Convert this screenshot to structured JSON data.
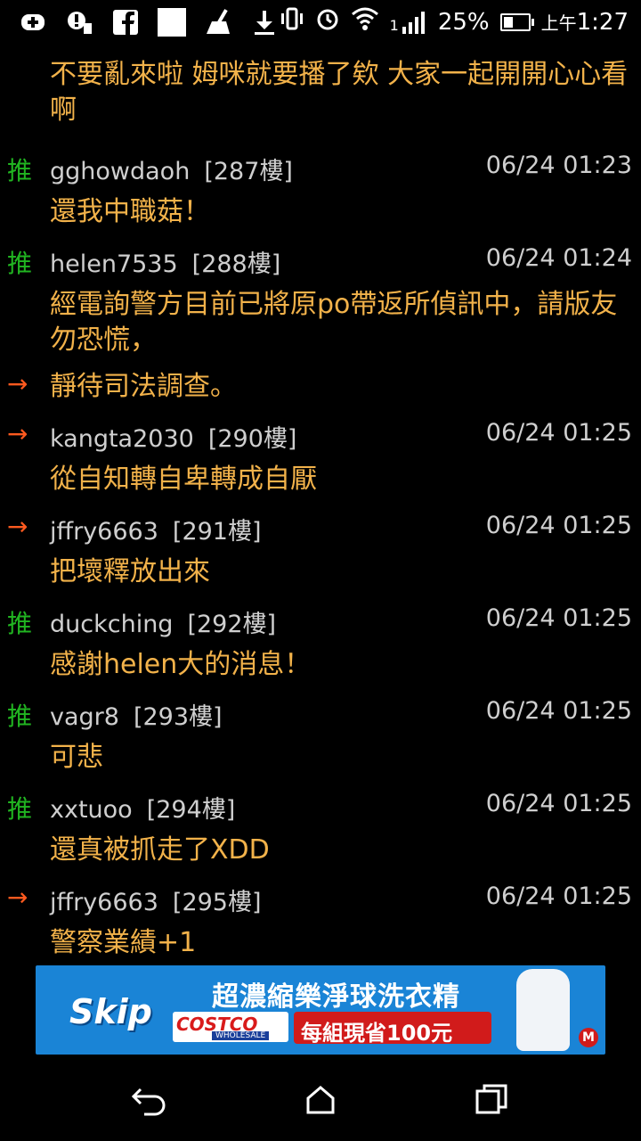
{
  "status_bar": {
    "icons_left": [
      "add-icon",
      "alert-icon",
      "facebook-icon",
      "blank-icon",
      "cleaner-icon",
      "download-icon"
    ],
    "icons_right": [
      "vibrate-icon",
      "alarm-icon",
      "wifi-icon",
      "signal-icon"
    ],
    "signal_label": "1",
    "battery": "25%",
    "time_prefix": "上午",
    "time": "1:27"
  },
  "feed": {
    "top_continuation": "不要亂來啦 姆咪就要播了欸 大家一起開開心心看啊",
    "comments": [
      {
        "tag": "推",
        "tag_type": "push",
        "user": "gghowdaoh",
        "floor": "[287樓]",
        "time": "06/24 01:23",
        "text": "還我中職菇！"
      },
      {
        "tag": "推",
        "tag_type": "push",
        "user": "helen7535",
        "floor": "[288樓]",
        "time": "06/24 01:24",
        "text": "經電詢警方目前已將原po帶返所偵訊中，請版友勿恐慌，",
        "follow_tag": "→",
        "follow_text": "靜待司法調查。"
      },
      {
        "tag": "→",
        "tag_type": "arrow",
        "user": "kangta2030",
        "floor": "[290樓]",
        "time": "06/24 01:25",
        "text": "從自知轉自卑轉成自厭"
      },
      {
        "tag": "→",
        "tag_type": "arrow",
        "user": "jffry6663",
        "floor": "[291樓]",
        "time": "06/24 01:25",
        "text": "把壞釋放出來"
      },
      {
        "tag": "推",
        "tag_type": "push",
        "user": "duckching",
        "floor": "[292樓]",
        "time": "06/24 01:25",
        "text": "感謝helen大的消息！"
      },
      {
        "tag": "推",
        "tag_type": "push",
        "user": "vagr8",
        "floor": "[293樓]",
        "time": "06/24 01:25",
        "text": "可悲"
      },
      {
        "tag": "推",
        "tag_type": "push",
        "user": "xxtuoo",
        "floor": "[294樓]",
        "time": "06/24 01:25",
        "text": "還真被抓走了XDD"
      },
      {
        "tag": "→",
        "tag_type": "arrow",
        "user": "jffry6663",
        "floor": "[295樓]",
        "time": "06/24 01:25",
        "text": "警察業績+1"
      }
    ]
  },
  "ad": {
    "brand": "Skip",
    "title": "超濃縮樂淨球洗衣精",
    "store": "COSTCO",
    "store_sub": "WHOLESALE",
    "promo": "每組現省100元",
    "badge": "M"
  },
  "nav": {
    "back_icon": "back-icon",
    "home_icon": "home-icon",
    "recent_icon": "recent-apps-icon"
  }
}
